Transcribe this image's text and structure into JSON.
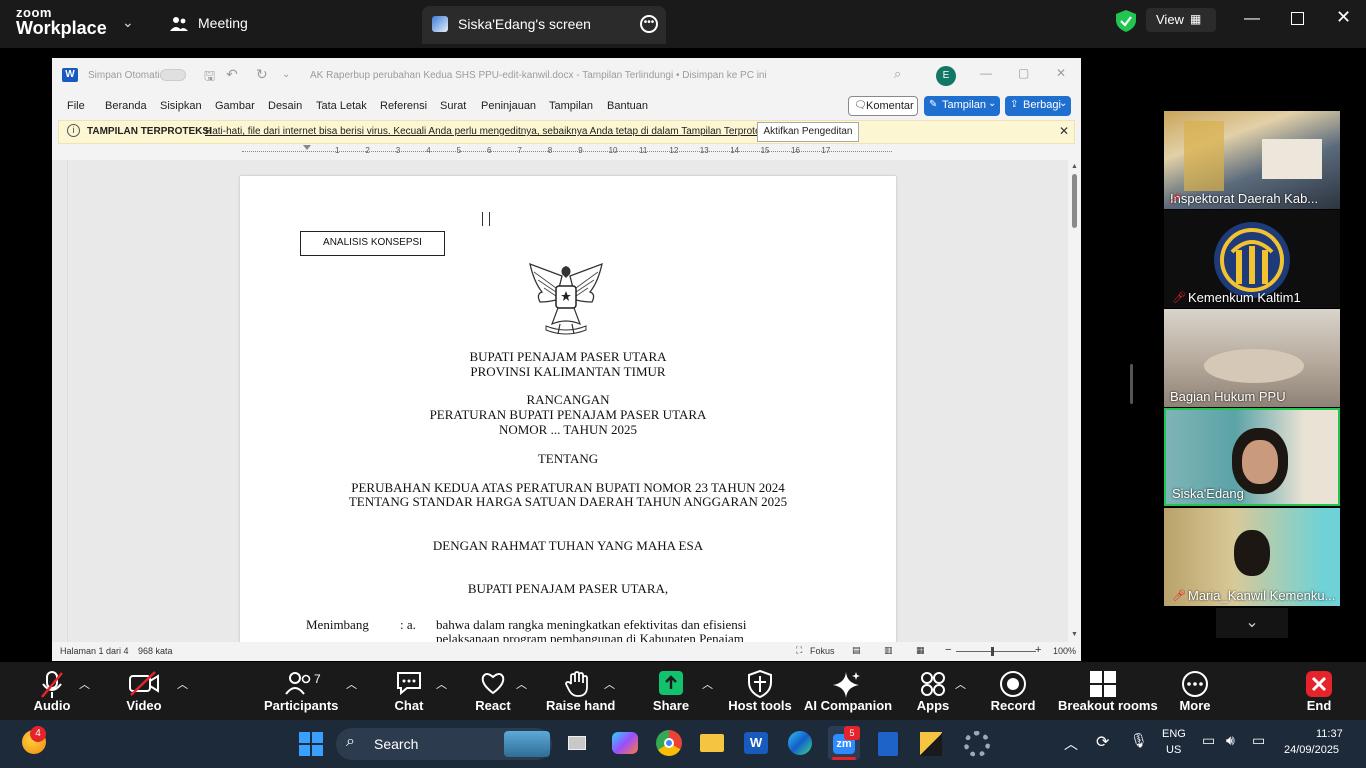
{
  "zoom": {
    "logo_top": "zoom",
    "logo_bottom": "Workplace",
    "meeting_tab": "Meeting",
    "share_tab": "Siska'Edang's screen",
    "view_label": "View"
  },
  "word": {
    "autosave": "Simpan Otomatis",
    "doc_title": "AK Raperbup perubahan Kedua SHS PPU-edit-kanwil.docx  -  Tampilan Terlindungi  •  Disimpan ke PC ini",
    "avatar": "E",
    "menus": [
      "File",
      "Beranda",
      "Sisipkan",
      "Gambar",
      "Desain",
      "Tata Letak",
      "Referensi",
      "Surat",
      "Peninjauan",
      "Tampilan",
      "Bantuan"
    ],
    "comment_btn": "Komentar",
    "view_btn": "Tampilan",
    "share_btn": "Berbagi",
    "protected_label": "TAMPILAN TERPROTEKSI",
    "protected_msg": "Hati-hati, file dari internet bisa berisi virus. Kecuali Anda perlu mengeditnya, sebaiknya Anda tetap di dalam Tampilan Terproteksi.",
    "enable_edit": "Aktifkan Pengeditan",
    "ruler_nums": [
      "1",
      "2",
      "3",
      "4",
      "5",
      "6",
      "7",
      "8",
      "9",
      "10",
      "11",
      "12",
      "13",
      "14",
      "15",
      "16",
      "17"
    ],
    "doc": {
      "box_label": "ANALISIS KONSEPSI",
      "l1": "BUPATI PENAJAM PASER UTARA",
      "l2": "PROVINSI KALIMANTAN TIMUR",
      "l3": "RANCANGAN",
      "l4": "PERATURAN BUPATI PENAJAM PASER UTARA",
      "l5": "NOMOR ... TAHUN 2025",
      "l6": "TENTANG",
      "l7": "PERUBAHAN KEDUA ATAS PERATURAN BUPATI NOMOR 23 TAHUN 2024",
      "l8": "TENTANG STANDAR HARGA SATUAN DAERAH TAHUN ANGGARAN 2025",
      "l9": "DENGAN RAHMAT TUHAN YANG MAHA ESA",
      "l10": "BUPATI PENAJAM PASER UTARA,",
      "menimbang": "Menimbang",
      "colon_a": ": a.",
      "para1": "bahwa dalam rangka meningkatkan efektivitas dan efisiensi",
      "para2": "pelaksanaan program pembangunan di Kabupaten Penajam"
    },
    "status_page": "Halaman 1 dari 4",
    "status_words": "968 kata",
    "focus": "Fokus",
    "zoom_pct": "100%"
  },
  "participants": [
    {
      "name": "Inspektorat Daerah Kab..."
    },
    {
      "name": "Kemenkum Kaltim1"
    },
    {
      "name": "Bagian Hukum PPU"
    },
    {
      "name": "Siska'Edang"
    },
    {
      "name": "Maria_Kanwil Kemenku..."
    }
  ],
  "toolbar": {
    "audio": "Audio",
    "video": "Video",
    "participants": "Participants",
    "participants_count": "7",
    "chat": "Chat",
    "react": "React",
    "raise_hand": "Raise hand",
    "share": "Share",
    "host_tools": "Host tools",
    "ai": "AI Companion",
    "apps": "Apps",
    "record": "Record",
    "breakout": "Breakout rooms",
    "more": "More",
    "end": "End"
  },
  "taskbar": {
    "search": "Search",
    "weather_badge": "4",
    "zoom_badge": "5",
    "lang1": "ENG",
    "lang2": "US",
    "time": "11:37",
    "date": "24/09/2025"
  },
  "colors": {
    "zoom_bg": "#1a1a1a",
    "word_blue": "#1f6fd0",
    "active_tile": "#23c552",
    "end_red": "#e5232b",
    "share_green": "#12c26d"
  }
}
